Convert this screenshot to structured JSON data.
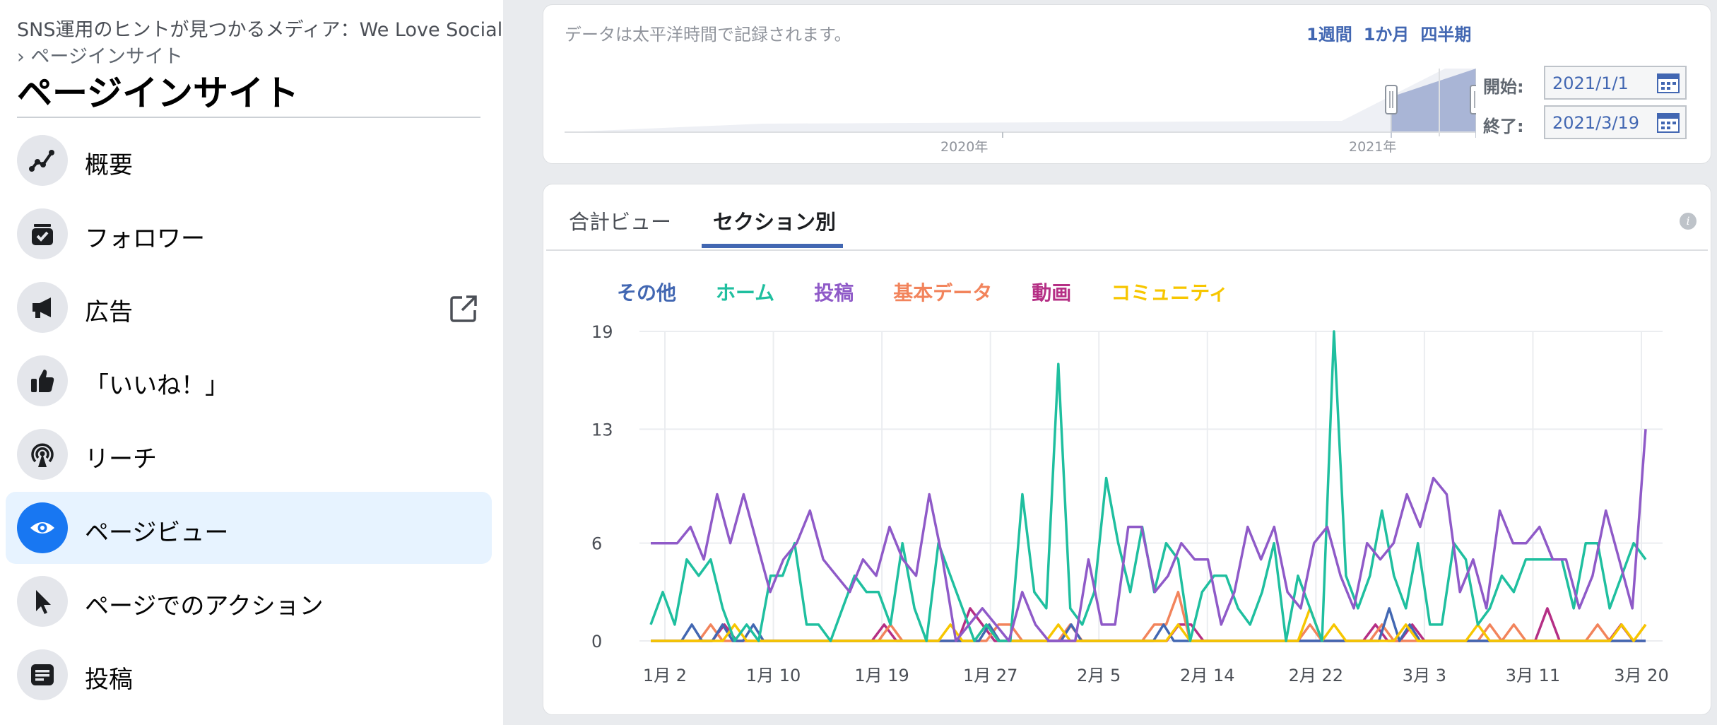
{
  "sidebar": {
    "breadcrumb_site": "SNS運用のヒントが見つかるメディア：We Love Social",
    "breadcrumb_page": "› ページインサイト",
    "title": "ページインサイト",
    "items": [
      {
        "label": "概要",
        "icon": "overview-icon"
      },
      {
        "label": "フォロワー",
        "icon": "followers-icon"
      },
      {
        "label": "広告",
        "icon": "megaphone-icon"
      },
      {
        "label": "「いいね！」",
        "icon": "thumbs-up-icon"
      },
      {
        "label": "リーチ",
        "icon": "broadcast-icon"
      },
      {
        "label": "ページビュー",
        "icon": "eye-icon"
      },
      {
        "label": "ページでのアクション",
        "icon": "cursor-icon"
      },
      {
        "label": "投稿",
        "icon": "post-icon"
      }
    ]
  },
  "range": {
    "note": "データは太平洋時間で記録されます。",
    "links": [
      "1週間",
      "1か月",
      "四半期"
    ],
    "year_labels": [
      "2020年",
      "2021年"
    ],
    "start_label": "開始:",
    "end_label": "終了:",
    "start_date": "2021/1/1",
    "end_date": "2021/3/19"
  },
  "tabs": {
    "total": "合計ビュー",
    "section": "セクション別"
  },
  "colors": {
    "other": "#4267b2",
    "home": "#1fbf9f",
    "posts": "#8f5ac8",
    "basic": "#f2845c",
    "video": "#b52f85",
    "community": "#f7c600"
  },
  "chart_data": {
    "type": "line",
    "x_labels": [
      "1月 2",
      "1月 10",
      "1月 19",
      "1月 27",
      "2月 5",
      "2月 14",
      "2月 22",
      "3月 3",
      "3月 11",
      "3月 20"
    ],
    "y_ticks": [
      0,
      6,
      13,
      19
    ],
    "ylim": [
      0,
      19
    ],
    "series": [
      {
        "name": "その他",
        "values": [
          0,
          0,
          0,
          0,
          1,
          0,
          0,
          1,
          0,
          0,
          1,
          0,
          0,
          0,
          0,
          0,
          0,
          0,
          0,
          0,
          0,
          0,
          0,
          0,
          0,
          0,
          0,
          0,
          0,
          0,
          0,
          0,
          0,
          1,
          0,
          0,
          0,
          0,
          0,
          0,
          0,
          1,
          0,
          0,
          0,
          0,
          0,
          0,
          0,
          0,
          1,
          0,
          0,
          0,
          0,
          0,
          0,
          0,
          0,
          0,
          0,
          0,
          0,
          0,
          0,
          0,
          0,
          0,
          0,
          0,
          0,
          0,
          2,
          0,
          1,
          0,
          0,
          0,
          0,
          0,
          0,
          0,
          0,
          0,
          0,
          0,
          0,
          0,
          0,
          0,
          0,
          0,
          0,
          0,
          0,
          0,
          0,
          0
        ]
      },
      {
        "name": "ホーム",
        "values": [
          1,
          3,
          1,
          5,
          4,
          5,
          2,
          0,
          1,
          0,
          4,
          4,
          6,
          1,
          1,
          0,
          2,
          4,
          3,
          3,
          1,
          6,
          2,
          0,
          6,
          4,
          2,
          0,
          1,
          0,
          0,
          9,
          3,
          2,
          17,
          2,
          1,
          3,
          10,
          6,
          3,
          7,
          3,
          6,
          5,
          0,
          3,
          4,
          4,
          2,
          1,
          3,
          6,
          0,
          4,
          2,
          0,
          19,
          4,
          2,
          4,
          8,
          4,
          2,
          6,
          1,
          1,
          6,
          5,
          1,
          2,
          4,
          3,
          5,
          5,
          5,
          5,
          2,
          6,
          6,
          2,
          4,
          6,
          5
        ]
      },
      {
        "name": "投稿",
        "values": [
          6,
          6,
          6,
          7,
          5,
          9,
          6,
          9,
          6,
          3,
          5,
          6,
          8,
          5,
          4,
          3,
          5,
          4,
          7,
          5,
          4,
          9,
          5,
          0,
          1,
          2,
          1,
          0,
          3,
          1,
          0,
          0,
          0,
          5,
          1,
          1,
          7,
          7,
          3,
          4,
          6,
          5,
          5,
          1,
          3,
          7,
          5,
          7,
          3,
          2,
          6,
          7,
          4,
          2,
          6,
          5,
          6,
          9,
          7,
          10,
          9,
          3,
          5,
          2,
          8,
          6,
          6,
          7,
          5,
          5,
          2,
          4,
          8,
          5,
          2,
          13
        ]
      },
      {
        "name": "基本データ",
        "values": [
          0,
          0,
          0,
          0,
          0,
          1,
          0,
          0,
          0,
          0,
          0,
          0,
          0,
          0,
          0,
          0,
          0,
          0,
          0,
          0,
          1,
          0,
          0,
          0,
          0,
          0,
          0,
          0,
          0,
          1,
          1,
          0,
          0,
          0,
          0,
          1,
          0,
          0,
          0,
          0,
          0,
          0,
          1,
          1,
          3,
          0,
          0,
          0,
          0,
          0,
          0,
          0,
          0,
          0,
          0,
          1,
          0,
          0,
          0,
          0,
          0,
          1,
          0,
          0,
          0,
          0,
          0,
          0,
          0,
          0,
          1,
          0,
          1,
          0,
          0,
          0,
          0,
          0,
          0,
          1,
          0,
          0,
          0,
          1
        ]
      },
      {
        "name": "動画",
        "values": [
          0,
          0,
          0,
          0,
          0,
          0,
          1,
          0,
          0,
          0,
          0,
          0,
          0,
          0,
          0,
          0,
          0,
          0,
          0,
          1,
          0,
          0,
          0,
          0,
          0,
          0,
          2,
          1,
          0,
          0,
          0,
          0,
          0,
          0,
          0,
          0,
          0,
          0,
          0,
          0,
          0,
          0,
          0,
          1,
          1,
          0,
          0,
          0,
          0,
          0,
          0,
          0,
          0,
          0,
          0,
          0,
          0,
          0,
          0,
          1,
          0,
          0,
          1,
          0,
          0,
          0,
          0,
          0,
          0,
          0,
          0,
          0,
          0,
          2,
          0,
          0,
          0,
          0,
          0,
          1,
          0,
          0
        ]
      },
      {
        "name": "コミュニティ",
        "values": [
          0,
          0,
          0,
          0,
          0,
          0,
          0,
          1,
          0,
          0,
          0,
          0,
          0,
          0,
          0,
          0,
          0,
          0,
          0,
          0,
          0,
          0,
          0,
          0,
          0,
          1,
          0,
          0,
          1,
          0,
          0,
          0,
          0,
          0,
          1,
          0,
          0,
          0,
          0,
          0,
          0,
          0,
          0,
          0,
          1,
          0,
          0,
          0,
          0,
          0,
          0,
          0,
          0,
          0,
          0,
          2,
          0,
          1,
          0,
          0,
          0,
          0,
          0,
          1,
          0,
          0,
          0,
          0,
          0,
          1,
          0,
          0,
          0,
          0,
          0,
          0,
          0,
          0,
          0,
          0,
          0,
          1,
          0,
          1
        ]
      }
    ]
  }
}
